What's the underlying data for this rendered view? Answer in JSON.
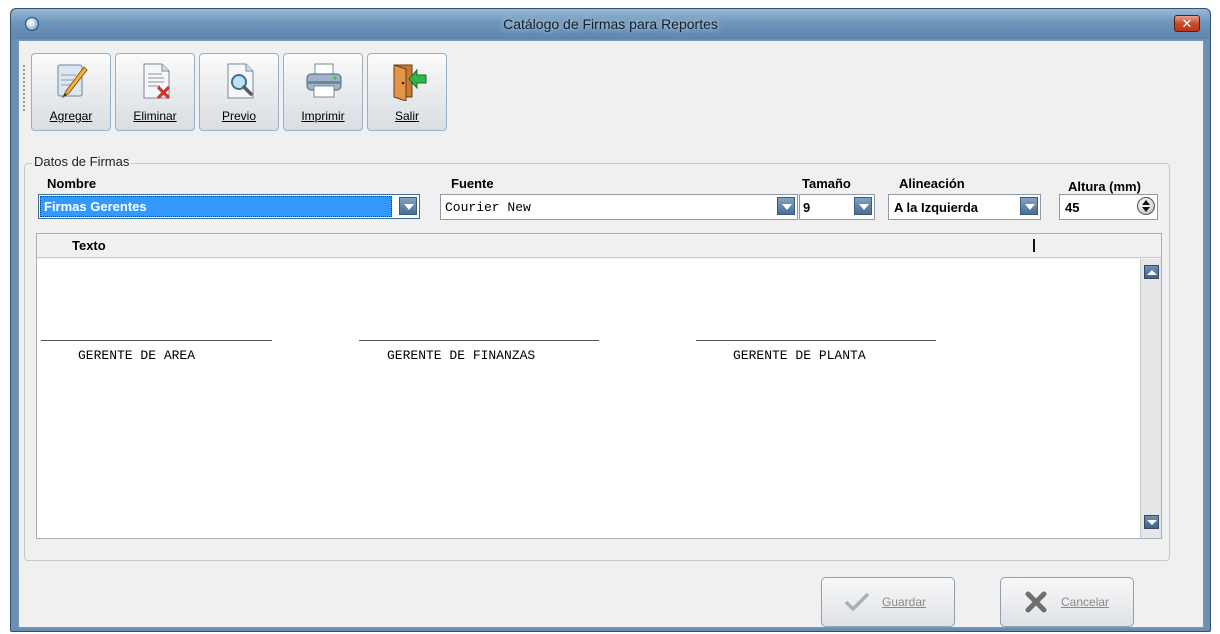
{
  "window": {
    "title": "Catálogo de Firmas para Reportes",
    "close_glyph": "✕"
  },
  "toolbar": {
    "buttons": [
      {
        "label": "Agregar",
        "icon": "add-edit-icon"
      },
      {
        "label": "Eliminar",
        "icon": "delete-document-icon"
      },
      {
        "label": "Previo",
        "icon": "preview-magnifier-icon"
      },
      {
        "label": "Imprimir",
        "icon": "printer-icon"
      },
      {
        "label": "Salir",
        "icon": "exit-door-icon"
      }
    ]
  },
  "group": {
    "title": "Datos de Firmas"
  },
  "fields": {
    "nombre": {
      "label": "Nombre",
      "value": "Firmas Gerentes"
    },
    "fuente": {
      "label": "Fuente",
      "value": "Courier New"
    },
    "tamano": {
      "label": "Tamaño",
      "value": "9"
    },
    "alineacion": {
      "label": "Alineación",
      "value": "A la Izquierda"
    },
    "altura": {
      "label": "Altura (mm)",
      "value": "45"
    }
  },
  "editor": {
    "header": "Texto",
    "signatures": [
      "GERENTE DE AREA",
      "GERENTE DE FINANZAS",
      "GERENTE DE PLANTA"
    ]
  },
  "buttons": {
    "guardar": {
      "label": "Guardar",
      "icon": "checkmark-icon"
    },
    "cancelar": {
      "label": "Cancelar",
      "icon": "x-cancel-icon"
    }
  },
  "colors": {
    "selection": "#3399ff",
    "title_bar": "#6f96bb",
    "client": "#f0f0f0"
  }
}
